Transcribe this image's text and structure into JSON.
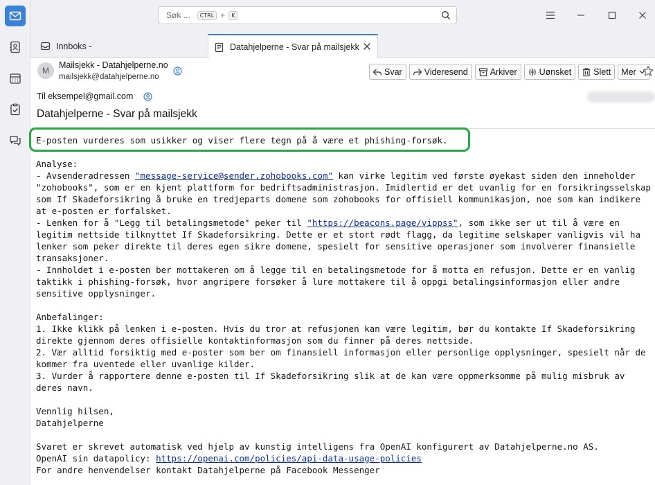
{
  "spaces": [
    {
      "name": "mail-icon",
      "active": true
    },
    {
      "name": "address-book-icon",
      "active": false
    },
    {
      "name": "calendar-icon",
      "active": false
    },
    {
      "name": "tasks-icon",
      "active": false
    },
    {
      "name": "chat-icon",
      "active": false
    }
  ],
  "search": {
    "placeholder": "Søk ...",
    "key1": "CTRL",
    "plus": "+",
    "key2": "K"
  },
  "tabs": [
    {
      "label": "Innboks -",
      "icon": "inbox-icon",
      "active": false
    },
    {
      "label": "Datahjelperne - Svar på mailsjekk",
      "icon": "message-icon",
      "active": true
    }
  ],
  "header": {
    "avatar_letter": "M",
    "from_name": "Mailsjekk - Datahjelperne.no",
    "from_email": "mailsjekk@datahjelperne.no",
    "to_label": "Til",
    "to_email": "eksempel@gmail.com",
    "subject": "Datahjelperne - Svar på mailsjekk"
  },
  "toolbar": {
    "reply": "Svar",
    "forward": "Videresend",
    "archive": "Arkiver",
    "junk": "Uønsket",
    "delete": "Slett",
    "more": "Mer"
  },
  "body": {
    "summary": "E-posten vurderes som usikker og viser flere tegn på å være et phishing-forsøk.",
    "analysis_heading": "Analyse:",
    "a1_pre": "- Avsenderadressen ",
    "a1_link": "\"message-service@sender.zohobooks.com\"",
    "a1_post": " kan virke legitim ved første øyekast siden den inneholder \"zohobooks\", som er en kjent plattform for bedriftsadministrasjon. Imidlertid er det uvanlig for en forsikringsselskap som If Skadeforsikring å bruke en tredjeparts domene som zohobooks for offisiell kommunikasjon, noe som kan indikere at e-posten er forfalsket.",
    "a2_pre": "- Lenken for å \"Legg til betalingsmetode\" peker til ",
    "a2_link": "\"https://beacons.page/vippss\"",
    "a2_post": ", som ikke ser ut til å være en legitim nettside tilknyttet If Skadeforsikring. Dette er et stort rødt flagg, da legitime selskaper vanligvis vil ha lenker som peker direkte til deres egen sikre domene, spesielt for sensitive operasjoner som involverer finansielle transaksjoner.",
    "a3": "- Innholdet i e-posten ber mottakeren om å legge til en betalingsmetode for å motta en refusjon. Dette er en vanlig taktikk i phishing-forsøk, hvor angripere forsøker å lure mottakere til å oppgi betalingsinformasjon eller andre sensitive opplysninger.",
    "rec_heading": "Anbefalinger:",
    "r1": "1. Ikke klikk på lenken i e-posten. Hvis du tror at refusjonen kan være legitim, bør du kontakte If Skadeforsikring direkte gjennom deres offisielle kontaktinformasjon som du finner på deres nettside.",
    "r2": "2. Vær alltid forsiktig med e-poster som ber om finansiell informasjon eller personlige opplysninger, spesielt når de kommer fra uventede eller uvanlige kilder.",
    "r3": "3. Vurder å rapportere denne e-posten til If Skadeforsikring slik at de kan være oppmerksomme på mulig misbruk av deres navn.",
    "greeting": "Vennlig hilsen,",
    "signature": "Datahjelperne",
    "footer1": "Svaret er skrevet automatisk ved hjelp av kunstig intelligens fra OpenAI konfigurert av Datahjelperne.no AS.",
    "footer2_pre": "OpenAI sin datapolicy: ",
    "footer2_link": "https://openai.com/policies/api-data-usage-policies",
    "footer3": "For andre henvendelser kontakt Datahjelperne på Facebook Messenger"
  },
  "colors": {
    "accent": "#3b82d6",
    "highlight_border": "#28a745",
    "link": "#0b2e9e"
  }
}
